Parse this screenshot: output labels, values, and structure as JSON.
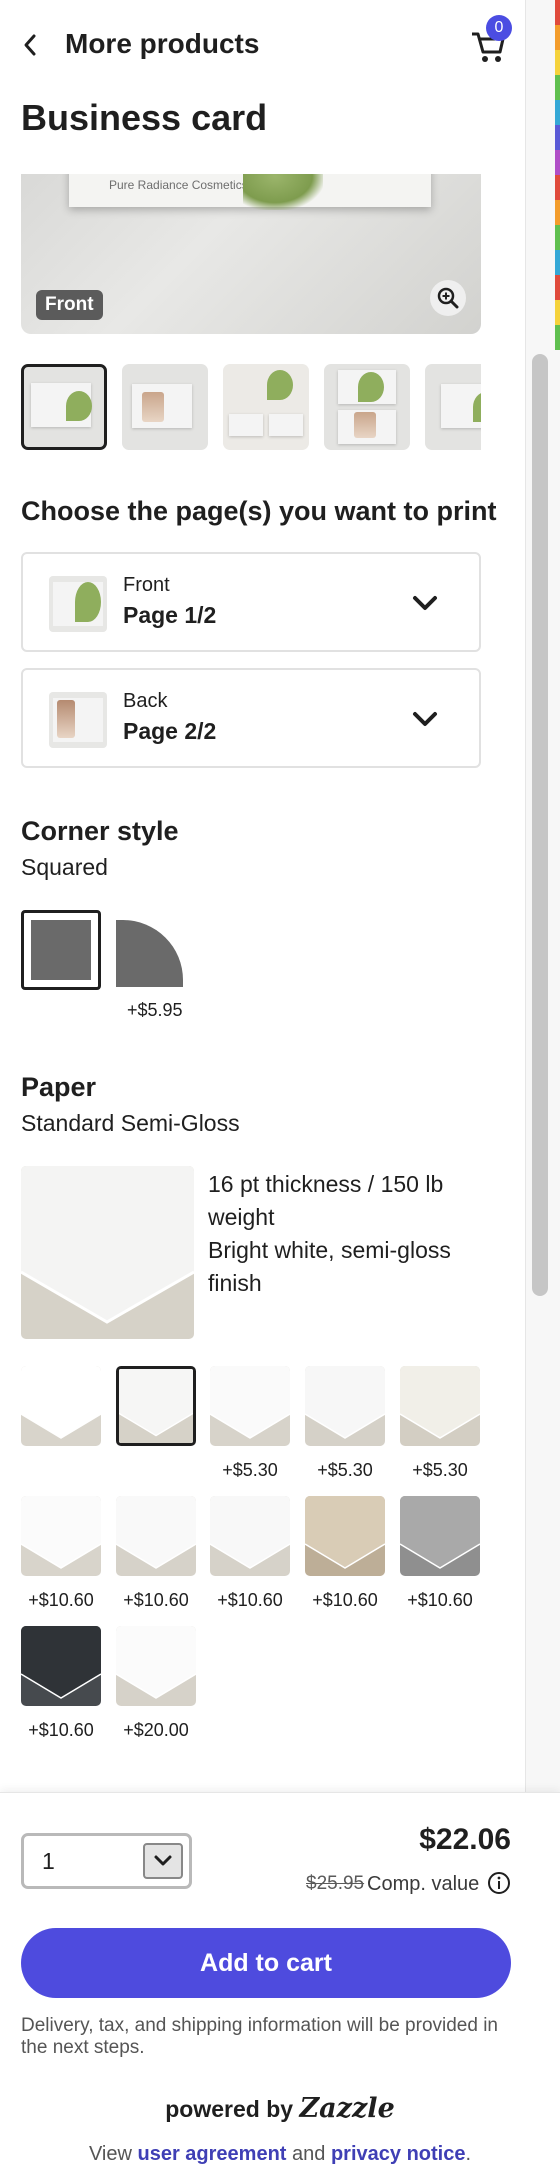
{
  "header": {
    "title": "More products",
    "cart_count": "0"
  },
  "page_title": "Business card",
  "preview": {
    "card_text": "Pure Radiance Cosmetics",
    "side_label": "Front"
  },
  "pages_section": {
    "heading": "Choose the page(s) you want to print",
    "front": {
      "label": "Front",
      "value": "Page 1/2"
    },
    "back": {
      "label": "Back",
      "value": "Page 2/2"
    }
  },
  "corner": {
    "heading": "Corner style",
    "selected": "Squared",
    "rounded_price": "+$5.95"
  },
  "paper": {
    "heading": "Paper",
    "selected": "Standard Semi-Gloss",
    "description": [
      "16 pt thickness / 150 lb weight",
      "Bright white, semi-gloss finish"
    ],
    "options": [
      {
        "price": ""
      },
      {
        "price": ""
      },
      {
        "price": "+$5.30"
      },
      {
        "price": "+$5.30"
      },
      {
        "price": "+$5.30"
      },
      {
        "price": "+$10.60"
      },
      {
        "price": "+$10.60"
      },
      {
        "price": "+$10.60"
      },
      {
        "price": "+$10.60"
      },
      {
        "price": "+$10.60"
      },
      {
        "price": "+$10.60"
      },
      {
        "price": "+$20.00"
      }
    ]
  },
  "footer": {
    "quantity": "1",
    "price": "$22.06",
    "old_price": "$25.95",
    "comp_label": "Comp. value",
    "add_to_cart": "Add to cart",
    "delivery_note": "Delivery, tax, and shipping information will be provided in the next steps.",
    "powered_by": "powered by",
    "brand": "Zazzle",
    "legal_prefix": "View",
    "legal_link1": "user agreement",
    "legal_and": "and",
    "legal_link2": "privacy notice",
    "legal_suffix": "."
  },
  "colors": {
    "accent": "#4e4bde",
    "badge": "#4b4de2"
  }
}
